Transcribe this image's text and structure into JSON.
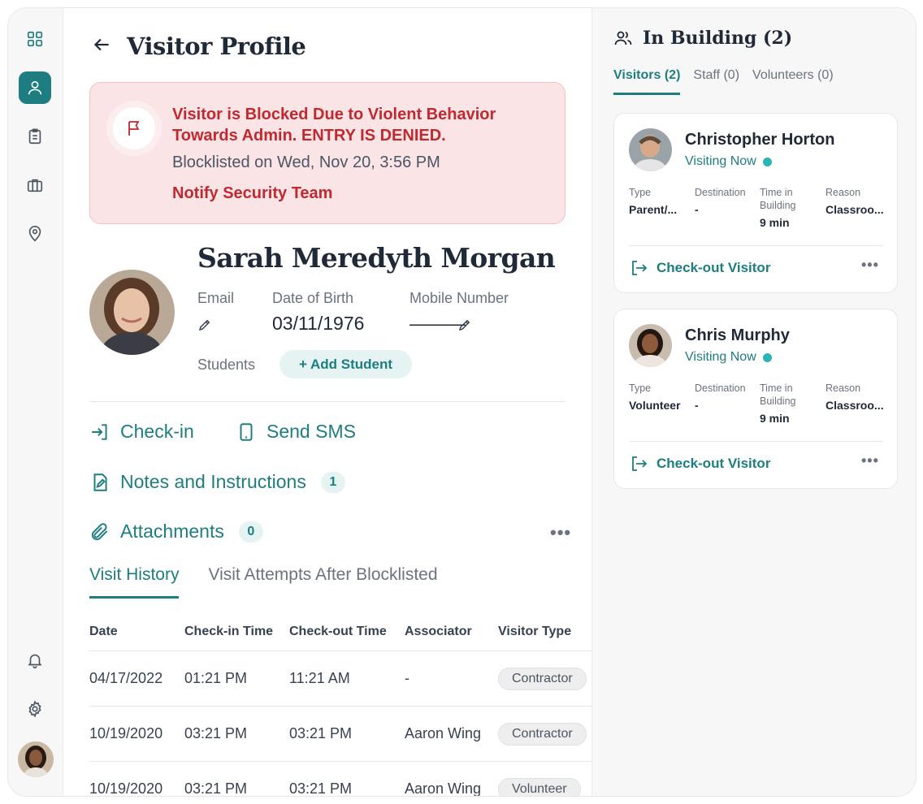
{
  "colors": {
    "accent": "#1d7d80",
    "danger": "#c0292f",
    "alert_bg": "#fbe4e5"
  },
  "sidebar": {
    "items": [
      {
        "name": "dashboard-icon",
        "active": false
      },
      {
        "name": "user-icon",
        "active": true
      },
      {
        "name": "clipboard-icon",
        "active": false
      },
      {
        "name": "briefcase-icon",
        "active": false
      },
      {
        "name": "location-icon",
        "active": false
      }
    ],
    "bottom": [
      {
        "name": "bell-icon"
      },
      {
        "name": "gear-icon"
      }
    ]
  },
  "header": {
    "title": "Visitor Profile"
  },
  "alert": {
    "title": "Visitor is Blocked Due to Violent Behavior Towards Admin. ENTRY IS DENIED.",
    "blocklisted": "Blocklisted on Wed, Nov 20, 3:56 PM",
    "notify": "Notify Security Team"
  },
  "profile": {
    "name": "Sarah Meredyth Morgan",
    "email_label": "Email",
    "dob_label": "Date of Birth",
    "dob_value": "03/11/1976",
    "mobile_label": "Mobile Number",
    "mobile_value": "———",
    "students_label": "Students",
    "add_student": "+ Add Student"
  },
  "actions": {
    "checkin": "Check-in",
    "send_sms": "Send SMS",
    "notes": "Notes and Instructions",
    "notes_count": "1",
    "attachments": "Attachments",
    "attachments_count": "0"
  },
  "tabs": [
    {
      "label": "Visit History",
      "active": true
    },
    {
      "label": "Visit Attempts After Blocklisted",
      "active": false
    }
  ],
  "table": {
    "headers": [
      "Date",
      "Check-in Time",
      "Check-out Time",
      "Associator",
      "Visitor Type"
    ],
    "rows": [
      {
        "date": "04/17/2022",
        "checkin": "01:21 PM",
        "checkout": "11:21 AM",
        "associator": "-",
        "type": "Contractor"
      },
      {
        "date": "10/19/2020",
        "checkin": "03:21 PM",
        "checkout": "03:21 PM",
        "associator": "Aaron Wing",
        "type": "Contractor"
      },
      {
        "date": "10/19/2020",
        "checkin": "03:21 PM",
        "checkout": "03:21 PM",
        "associator": "Aaron Wing",
        "type": "Volunteer"
      }
    ]
  },
  "in_building": {
    "title": "In Building (2)",
    "tabs": [
      {
        "label": "Visitors (2)",
        "active": true
      },
      {
        "label": "Staff (0)",
        "active": false
      },
      {
        "label": "Volunteers (0)",
        "active": false
      }
    ],
    "cards": [
      {
        "name": "Christopher Horton",
        "status": "Visiting Now",
        "type_label": "Type",
        "type": "Parent/...",
        "dest_label": "Destination",
        "dest": "-",
        "time_label": "Time in Building",
        "time": "9 min",
        "reason_label": "Reason",
        "reason": "Classroo...",
        "checkout": "Check-out Visitor"
      },
      {
        "name": "Chris Murphy",
        "status": "Visiting Now",
        "type_label": "Type",
        "type": "Volunteer",
        "dest_label": "Destination",
        "dest": "-",
        "time_label": "Time in Building",
        "time": "9 min",
        "reason_label": "Reason",
        "reason": "Classroo...",
        "checkout": "Check-out Visitor"
      }
    ]
  }
}
